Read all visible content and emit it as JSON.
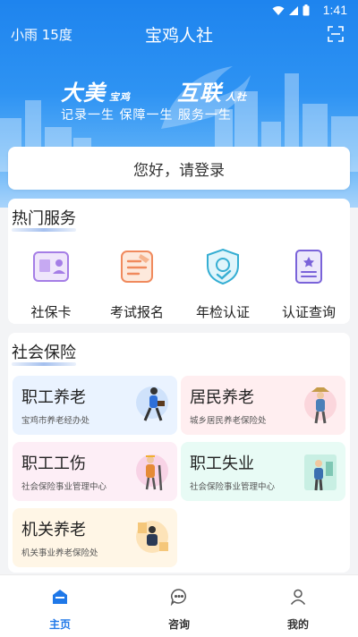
{
  "status": {
    "time": "1:41"
  },
  "header": {
    "weather": "小雨 15度",
    "title": "宝鸡人社"
  },
  "banner": {
    "slogan_left": "大美",
    "slogan_left_small": "宝鸡",
    "slogan_right": "互联",
    "slogan_right_small": "人社",
    "subline": "记录一生  保障一生  服务一生"
  },
  "login": {
    "label": "您好，请登录"
  },
  "hot_services": {
    "title": "热门服务",
    "items": [
      {
        "label": "社保卡",
        "icon": "id-card-icon"
      },
      {
        "label": "考试报名",
        "icon": "exam-signup-icon"
      },
      {
        "label": "年检认证",
        "icon": "shield-check-icon"
      },
      {
        "label": "认证查询",
        "icon": "certificate-query-icon"
      }
    ]
  },
  "social_insurance": {
    "title": "社会保险",
    "tiles": [
      {
        "title": "职工养老",
        "subtitle": "宝鸡市养老经办处",
        "color": "#eaf3ff"
      },
      {
        "title": "居民养老",
        "subtitle": "城乡居民养老保险处",
        "color": "#ffeef0"
      },
      {
        "title": "职工工伤",
        "subtitle": "社会保险事业管理中心",
        "color": "#fdeef6"
      },
      {
        "title": "职工失业",
        "subtitle": "社会保险事业管理中心",
        "color": "#e8fbf5"
      },
      {
        "title": "机关养老",
        "subtitle": "机关事业养老保险处",
        "color": "#fff6e6"
      }
    ]
  },
  "tabbar": {
    "items": [
      {
        "label": "主页",
        "icon": "home-icon",
        "active": true
      },
      {
        "label": "咨询",
        "icon": "chat-icon",
        "active": false
      },
      {
        "label": "我的",
        "icon": "user-icon",
        "active": false
      }
    ]
  },
  "colors": {
    "brand": "#1f78e8",
    "hero_top": "#1e84ee"
  }
}
